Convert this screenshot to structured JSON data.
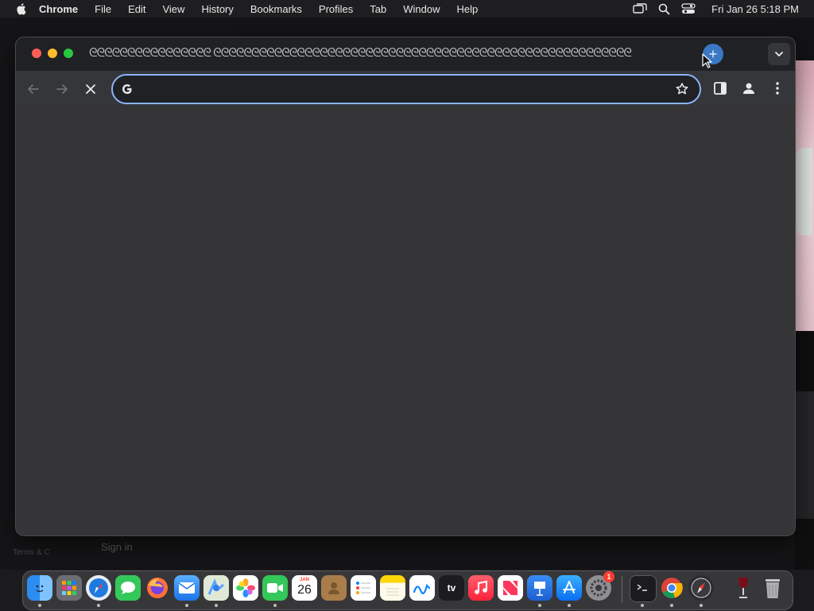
{
  "menubar": {
    "app_name": "Chrome",
    "items": [
      "File",
      "Edit",
      "View",
      "History",
      "Bookmarks",
      "Profiles",
      "Tab",
      "Window",
      "Help"
    ],
    "clock": "Fri Jan 26  5:18 PM"
  },
  "window": {
    "tab_strip_text": "ᘓᘓᘓᘓᘓᘓᘓᘓᘓᘓᘓᘓᘓᘓᘓᘓ ᘓᘓᘓᘓᘓᘓᘓᘓᘓᘓᘓᘓᘓᘓᘓᘓᘓᘓᘓᘓᘓᘓᘓᘓᘓᘓᘓᘓᘓᘓᘓᘓᘓᘓᘓᘓᘓᘓᘓᘓᘓᘓᘓᘓᘓᘓᘓᘓᘓᘓᘓᘓᘓᘓᘓ",
    "new_tab_label": "+",
    "omnibox": {
      "value": "",
      "placeholder": ""
    }
  },
  "background": {
    "sign_in_label": "Sign in",
    "terms_label": "Terms & C"
  },
  "dock": {
    "calendar_day": "26",
    "calendar_month": "JAN",
    "settings_badge": "1",
    "tv_label": "tv",
    "icons": [
      "finder-icon",
      "launchpad-icon",
      "safari-icon",
      "messages-icon",
      "firefox-icon",
      "mail-icon",
      "maps-icon",
      "photos-icon",
      "facetime-icon",
      "calendar-icon",
      "contacts-icon",
      "reminders-icon",
      "notes-icon",
      "freeform-icon",
      "apple-tv-icon",
      "music-icon",
      "news-icon",
      "keynote-icon",
      "app-store-icon",
      "system-settings-icon",
      "terminal-icon",
      "chrome-icon",
      "compass-icon",
      "wine-icon",
      "trash-icon"
    ]
  }
}
